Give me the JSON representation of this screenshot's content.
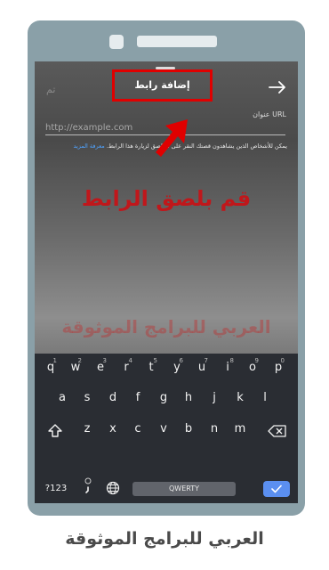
{
  "dialog": {
    "done_label": "تم",
    "title": "إضافة رابط",
    "url_label": "عنوان URL",
    "url_placeholder": "http://example.com",
    "help_text": "يمكن للأشخاص الذين يشاهدون قصتك النقر على الملصق لزيارة هذا الرابط.",
    "help_link": "معرفة المزيد"
  },
  "overlay": {
    "instruction": "قم بلصق الرابط",
    "watermark": "العربي للبرامج الموثوقة",
    "annotation_color": "#e00000"
  },
  "keyboard": {
    "row1": [
      {
        "key": "q",
        "hint": "1"
      },
      {
        "key": "w",
        "hint": "2"
      },
      {
        "key": "e",
        "hint": "3"
      },
      {
        "key": "r",
        "hint": "4"
      },
      {
        "key": "t",
        "hint": "5"
      },
      {
        "key": "y",
        "hint": "6"
      },
      {
        "key": "u",
        "hint": "7"
      },
      {
        "key": "i",
        "hint": "8"
      },
      {
        "key": "o",
        "hint": "9"
      },
      {
        "key": "p",
        "hint": "0"
      }
    ],
    "row2": [
      "a",
      "s",
      "d",
      "f",
      "g",
      "h",
      "j",
      "k",
      "l"
    ],
    "row3": [
      "z",
      "x",
      "c",
      "v",
      "b",
      "n",
      "m"
    ],
    "symbols_label": "?123",
    "space_label": "QWERTY",
    "accent_color": "#5b8ff0"
  },
  "caption": "العربي للبرامج الموثوقة"
}
